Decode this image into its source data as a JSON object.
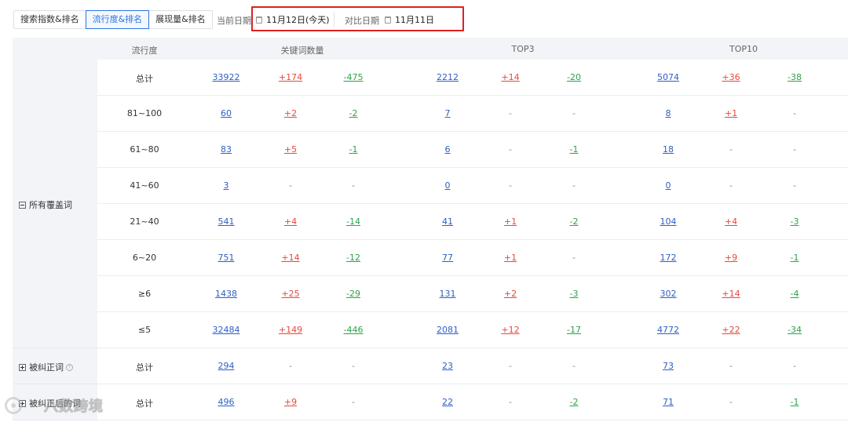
{
  "toolbar": {
    "tabs": [
      {
        "label": "搜索指数&排名",
        "active": false
      },
      {
        "label": "流行度&排名",
        "active": true
      },
      {
        "label": "展现量&排名",
        "active": false
      }
    ],
    "current_date_label": "当前日期",
    "current_date_value": "11月12日(今天)",
    "compare_date_label": "对比日期",
    "compare_date_value": "11月11日"
  },
  "table": {
    "headers": {
      "popularity": "流行度",
      "keyword_count": "关键词数量",
      "top3": "TOP3",
      "top10": "TOP10"
    },
    "groups": [
      {
        "label": "所有覆盖词",
        "toggle": "minus",
        "help": false
      },
      {
        "label": "被纠正词",
        "toggle": "plus",
        "help": true
      },
      {
        "label": "被纠正后的词",
        "toggle": "plus",
        "help": false
      }
    ],
    "rows": [
      {
        "label": "总计",
        "cells": [
          "33922",
          "+174",
          "-475",
          "2212",
          "+14",
          "-20",
          "5074",
          "+36",
          "-38"
        ]
      },
      {
        "label": "81~100",
        "cells": [
          "60",
          "+2",
          "-2",
          "7",
          "-",
          "-",
          "8",
          "+1",
          "-"
        ]
      },
      {
        "label": "61~80",
        "cells": [
          "83",
          "+5",
          "-1",
          "6",
          "-",
          "-1",
          "18",
          "-",
          "-"
        ]
      },
      {
        "label": "41~60",
        "cells": [
          "3",
          "-",
          "-",
          "0",
          "-",
          "-",
          "0",
          "-",
          "-"
        ]
      },
      {
        "label": "21~40",
        "cells": [
          "541",
          "+4",
          "-14",
          "41",
          "+1",
          "-2",
          "104",
          "+4",
          "-3"
        ]
      },
      {
        "label": "6~20",
        "cells": [
          "751",
          "+14",
          "-12",
          "77",
          "+1",
          "-",
          "172",
          "+9",
          "-1"
        ]
      },
      {
        "label": "≥6",
        "cells": [
          "1438",
          "+25",
          "-29",
          "131",
          "+2",
          "-3",
          "302",
          "+14",
          "-4"
        ]
      },
      {
        "label": "≤5",
        "cells": [
          "32484",
          "+149",
          "-446",
          "2081",
          "+12",
          "-17",
          "4772",
          "+22",
          "-34"
        ]
      },
      {
        "label": "总计",
        "cells": [
          "294",
          "-",
          "-",
          "23",
          "-",
          "-",
          "73",
          "-",
          "-"
        ]
      },
      {
        "label": "总计",
        "cells": [
          "496",
          "+9",
          "-",
          "22",
          "-",
          "-2",
          "71",
          "-",
          "-1"
        ]
      }
    ]
  },
  "watermark": {
    "text": "八数跨境"
  },
  "colors": {
    "accent": "#2f74e0",
    "link": "#2f5fc4",
    "increase": "#e8483e",
    "decrease": "#2ea24a",
    "highlight": "#e02020",
    "header_bg": "#f2f4f7"
  }
}
